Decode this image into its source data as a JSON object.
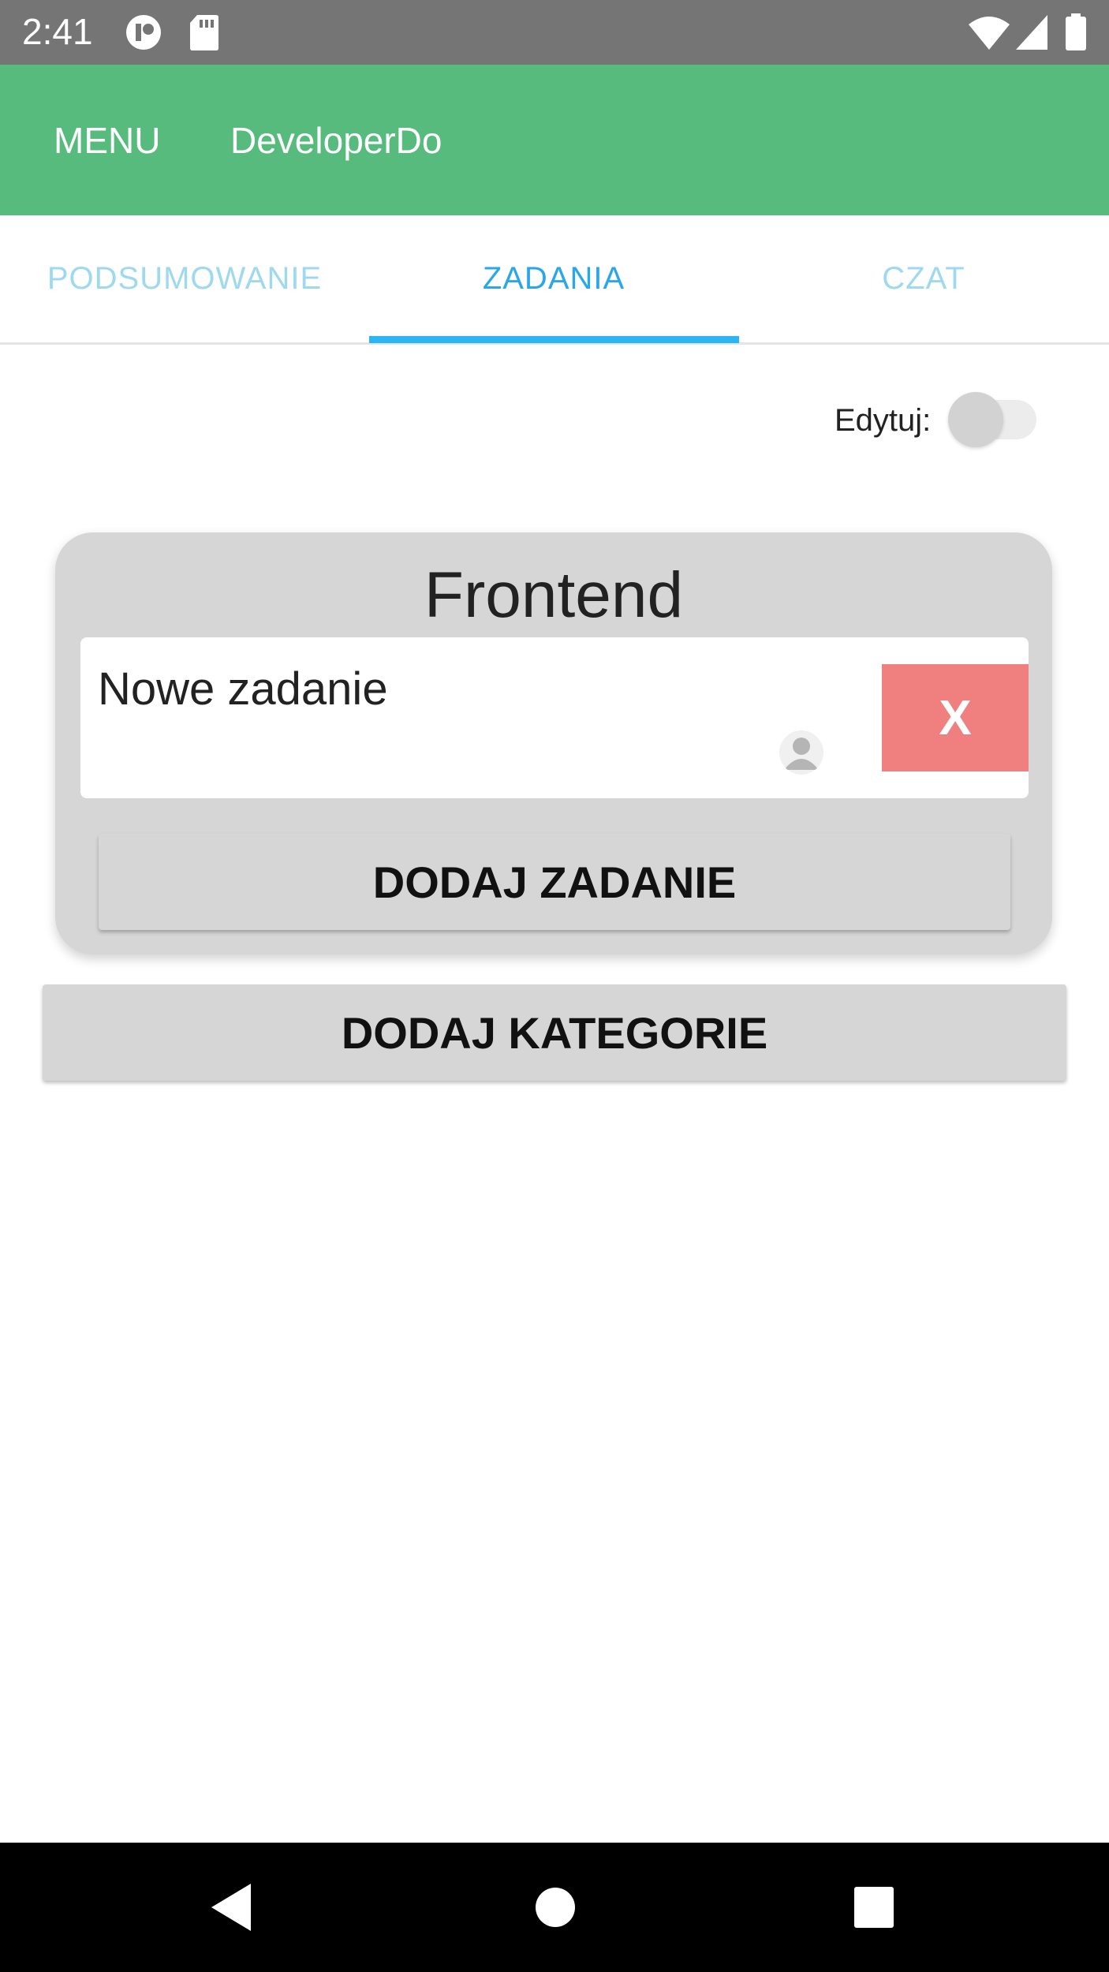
{
  "status_bar": {
    "time": "2:41",
    "icons": [
      "media-icon",
      "sd-card-icon",
      "wifi-icon",
      "signal-icon",
      "battery-icon"
    ]
  },
  "app_bar": {
    "menu_label": "MENU",
    "title": "DeveloperDo",
    "color": "#57bb7d"
  },
  "tabs": [
    {
      "label": "PODSUMOWANIE",
      "active": false
    },
    {
      "label": "ZADANIA",
      "active": true
    },
    {
      "label": "CZAT",
      "active": false
    }
  ],
  "edit_toggle": {
    "label": "Edytuj:",
    "on": false
  },
  "category": {
    "title": "Frontend",
    "tasks": [
      {
        "name": "Nowe zadanie",
        "delete_label": "X",
        "avatar_icon": "user-avatar-icon"
      }
    ],
    "add_task_label": "DODAJ ZADANIE"
  },
  "add_category_label": "DODAJ KATEGORIE",
  "nav_bar": {
    "icons": [
      "back-icon",
      "home-icon",
      "recents-icon"
    ]
  },
  "colors": {
    "accent": "#2ab5f3",
    "delete": "#f08080",
    "card": "#d6d6d6"
  }
}
